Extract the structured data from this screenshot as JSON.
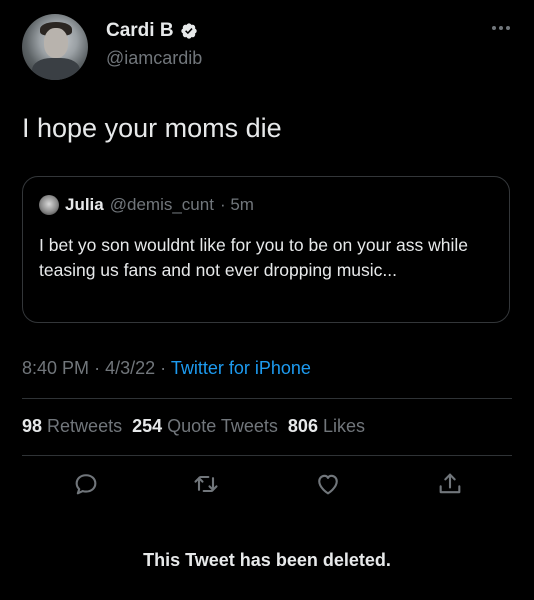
{
  "author": {
    "name": "Cardi B",
    "handle": "@iamcardib"
  },
  "tweet": {
    "text": "I hope your moms die"
  },
  "quoted_tweet": {
    "name": "Julia",
    "handle": "@demis_cunt",
    "time": "· 5m",
    "text": "I bet yo son wouldnt like for you to be on your ass while teasing us fans and not ever dropping music..."
  },
  "meta": {
    "time": "8:40 PM",
    "date": "4/3/22",
    "separator": "·",
    "source": "Twitter for iPhone"
  },
  "stats": {
    "retweets_count": "98",
    "retweets_label": "Retweets",
    "quotes_count": "254",
    "quotes_label": "Quote Tweets",
    "likes_count": "806",
    "likes_label": "Likes"
  },
  "notice": "This Tweet has been deleted.",
  "colors": {
    "background": "#000000",
    "text": "#e7e9ea",
    "secondary": "#71767b",
    "link": "#1d9bf0",
    "verified": "#1d9bf0",
    "border": "#2f3336"
  },
  "icons": {
    "reply": "reply-icon",
    "retweet": "retweet-icon",
    "like": "like-icon",
    "share": "share-icon",
    "more": "more-icon",
    "verified": "verified-badge-icon"
  }
}
